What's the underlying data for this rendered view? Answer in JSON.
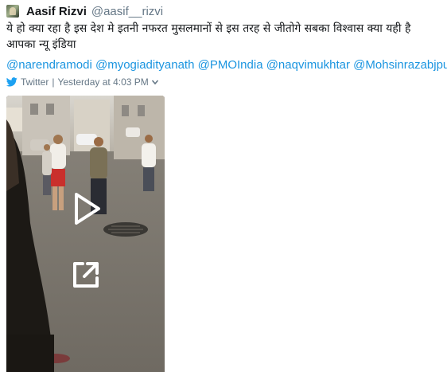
{
  "tweet": {
    "display_name": "Aasif Rizvi",
    "handle": "@aasif__rizvi",
    "text": "ये हो क्या रहा है इस देश मे इतनी नफरत मुसलमानों से इस तरह से जीतोगे सबका विश्वास क्या यही है आपका न्यू इंडिया",
    "mentions": [
      "@narendramodi",
      "@myogiadityanath",
      "@PMOIndia",
      "@naqvimukhtar",
      "@Mohsinrazabjpup"
    ],
    "source": "Twitter",
    "separator": "|",
    "timestamp": "Yesterday at 4:03 PM"
  },
  "colors": {
    "link": "#1b95e0",
    "meta": "#657786",
    "name": "#14171a",
    "twitter_bird": "#1da1f2"
  },
  "icons": {
    "avatar": "user-avatar",
    "source": "twitter-bird-icon",
    "menu": "chevron-down-icon",
    "play": "play-icon",
    "expand": "expand-icon"
  }
}
